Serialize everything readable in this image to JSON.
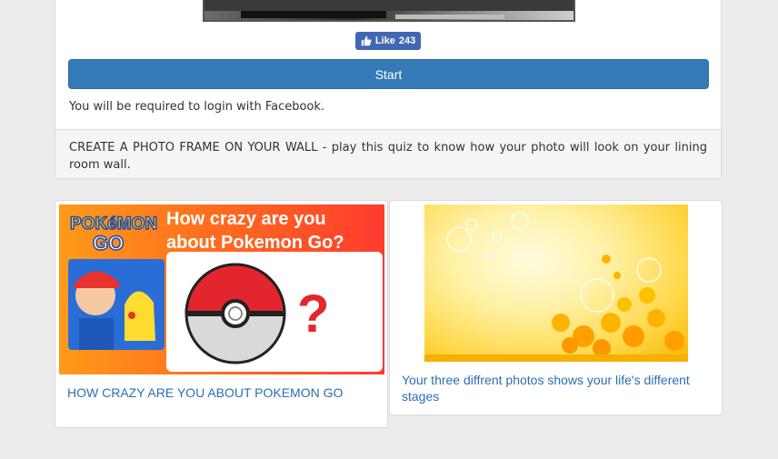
{
  "like": {
    "label": "Like",
    "count": "243"
  },
  "start": {
    "label": "Start"
  },
  "login_note": "You will be required to login with Facebook.",
  "description": "CREATE A PHOTO FRAME ON YOUR WALL - play this quiz to know how your photo will look on your lining room wall.",
  "quizzes": [
    {
      "title": "HOW CRAZY ARE YOU ABOUT POKEMON GO",
      "image_text": {
        "logo_top": "POKéMON",
        "logo_bottom": "GO",
        "headline_1": "How crazy are you",
        "headline_2": "about Pokemon Go?",
        "mark": "?"
      }
    },
    {
      "title": "Your three diffrent photos shows your life's different stages"
    }
  ],
  "colors": {
    "accent": "#337ab7",
    "facebook": "#4267b2",
    "link": "#2a6fb4"
  },
  "icons": {
    "like": "thumbs-up-icon",
    "pokeball": "pokeball-icon"
  }
}
